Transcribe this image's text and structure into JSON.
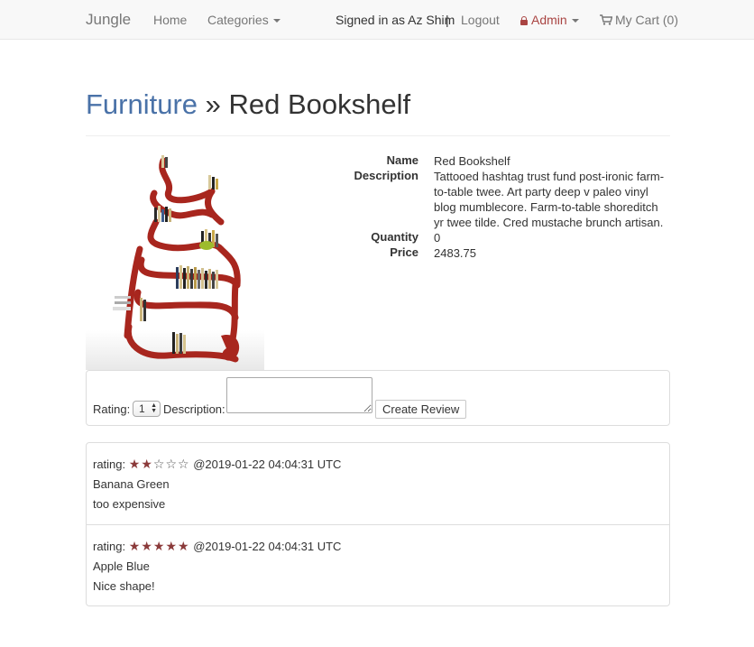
{
  "navbar": {
    "brand": "Jungle",
    "home": "Home",
    "categories": "Categories",
    "signed_in": "Signed in as Az Shim",
    "separator": "|",
    "logout": "Logout",
    "admin": "Admin",
    "cart": "My Cart (0)"
  },
  "header": {
    "category": "Furniture",
    "separator": " » ",
    "product": "Red Bookshelf"
  },
  "details": {
    "name_label": "Name",
    "name_value": "Red Bookshelf",
    "description_label": "Description",
    "description_value": "Tattooed hashtag trust fund post-ironic farm-to-table twee. Art party deep v paleo vinyl blog mumblecore. Farm-to-table shoreditch yr twee tilde. Cred mustache brunch artisan.",
    "quantity_label": "Quantity",
    "quantity_value": "0",
    "price_label": "Price",
    "price_value": "2483.75"
  },
  "review_form": {
    "rating_label": "Rating:",
    "rating_value": "1",
    "description_label": "Description:",
    "description_value": "",
    "submit_label": "Create Review"
  },
  "reviews": [
    {
      "rating_label": "rating:",
      "stars": 2,
      "max_stars": 5,
      "timestamp": "@2019-01-22 04:04:31 UTC",
      "author": "Banana Green",
      "text": "too expensive"
    },
    {
      "rating_label": "rating:",
      "stars": 5,
      "max_stars": 5,
      "timestamp": "@2019-01-22 04:04:31 UTC",
      "author": "Apple Blue",
      "text": "Nice shape!"
    }
  ],
  "colors": {
    "navbar_bg": "#f8f8f8",
    "link": "#4a72a8",
    "admin": "#a94442",
    "star": "#8b3a3a"
  }
}
